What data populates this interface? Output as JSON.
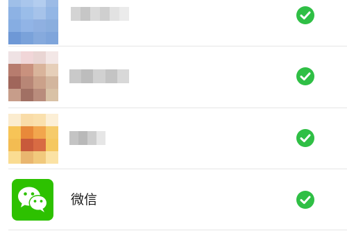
{
  "app_list": {
    "items": [
      {
        "name": "",
        "name_obscured": true,
        "icon": "blurred-app-icon",
        "selected": true
      },
      {
        "name": "",
        "name_obscured": true,
        "icon": "blurred-app-icon",
        "selected": true
      },
      {
        "name": "",
        "name_obscured": true,
        "icon": "blurred-app-icon",
        "selected": true
      },
      {
        "name": "微信",
        "name_obscured": false,
        "icon": "wechat-icon",
        "selected": true
      }
    ]
  },
  "colors": {
    "checkmark_green": "#2fbf45",
    "wechat_green": "#2dc100",
    "divider": "#e6e6e6",
    "background": "#ffffff"
  }
}
